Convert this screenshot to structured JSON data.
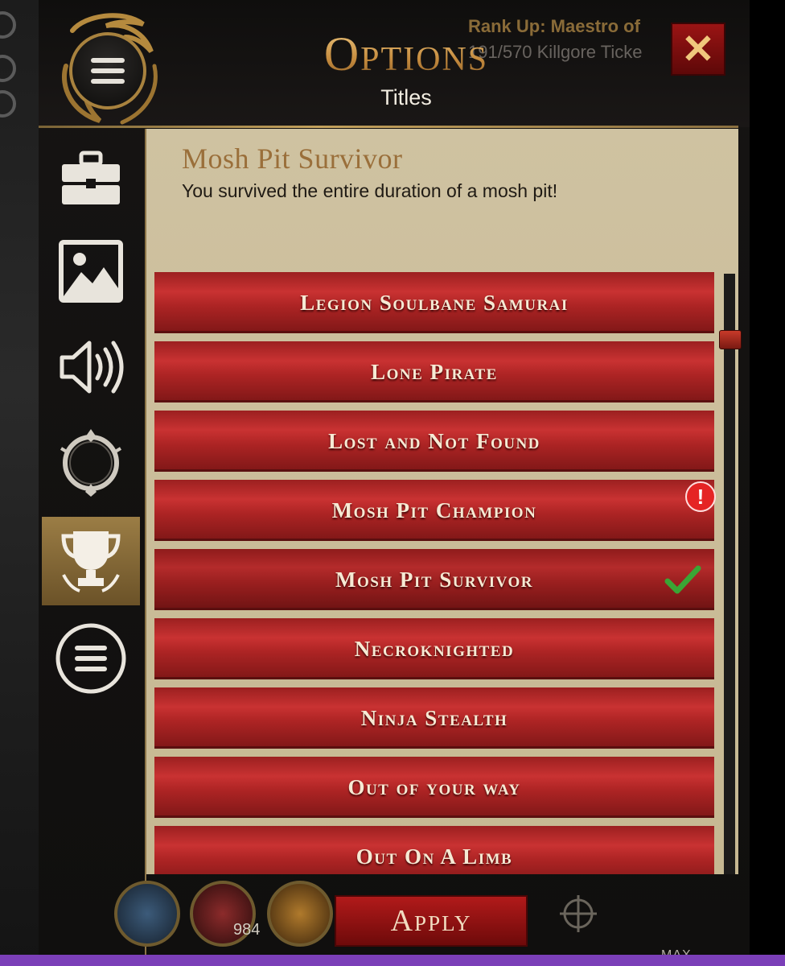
{
  "header": {
    "title": "Options",
    "subtitle": "Titles",
    "close_label": "✕"
  },
  "notification": {
    "line1": "Rank Up: Maestro of",
    "line2": "191/570 Killgore Ticke"
  },
  "sidebar": {
    "items": [
      {
        "name": "toolbox",
        "active": false
      },
      {
        "name": "image",
        "active": false
      },
      {
        "name": "sound",
        "active": false
      },
      {
        "name": "frame",
        "active": false
      },
      {
        "name": "trophy",
        "active": true
      },
      {
        "name": "menu",
        "active": false
      }
    ]
  },
  "description": {
    "title": "Mosh Pit Survivor",
    "text": "You survived the entire duration of a mosh pit!"
  },
  "titles": [
    {
      "label": "Legion Soulbane Samurai"
    },
    {
      "label": "Lone Pirate"
    },
    {
      "label": "Lost and Not Found"
    },
    {
      "label": "Mosh Pit Champion",
      "badge": "!"
    },
    {
      "label": "Mosh Pit Survivor",
      "selected": true
    },
    {
      "label": "Necroknighted"
    },
    {
      "label": "Ninja Stealth"
    },
    {
      "label": "Out of your way"
    },
    {
      "label": "Out On A Limb"
    }
  ],
  "footer": {
    "apply_label": "Apply",
    "hud_count": "984",
    "hud_max": "MAX"
  },
  "colors": {
    "accent_gold": "#c4a25d",
    "row_red": "#c93232",
    "check_green": "#3aa535",
    "badge_red": "#e52424"
  }
}
